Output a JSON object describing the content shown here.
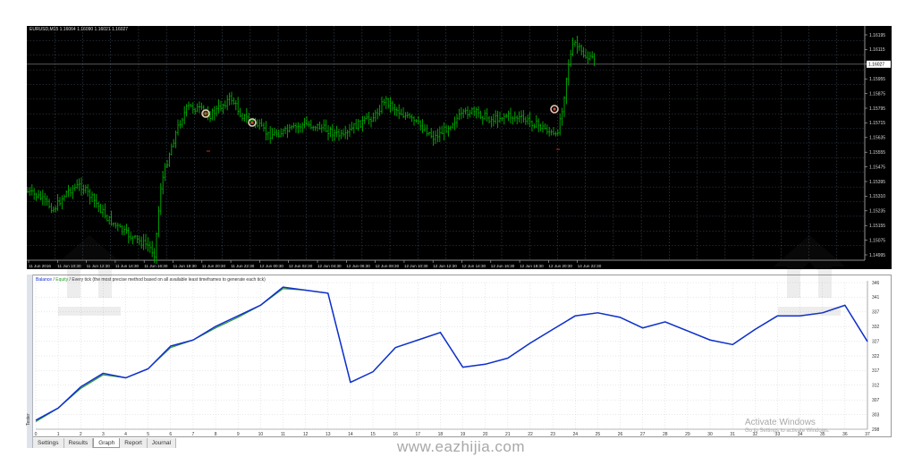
{
  "price_chart": {
    "symbol_line": "EURUSD,M15  1.16064 1.16090 1.16021 1.16027",
    "current_price": "1.16027",
    "price_labels": [
      "1.16195",
      "1.16115",
      "1.16027",
      "1.15955",
      "1.15875",
      "1.15795",
      "1.15715",
      "1.15635",
      "1.15555",
      "1.15475",
      "1.15395",
      "1.15310",
      "1.15235",
      "1.15155",
      "1.15075",
      "1.14995"
    ],
    "time_labels": [
      "11 Jun 2016",
      "11 Jun 10:30",
      "11 Jun 12:30",
      "11 Jun 14:30",
      "11 Jun 16:30",
      "11 Jun 18:30",
      "11 Jun 20:30",
      "11 Jun 22:30",
      "12 Jun 00:30",
      "12 Jun 02:30",
      "12 Jun 04:30",
      "12 Jun 06:30",
      "12 Jun 08:30",
      "12 Jun 10:30",
      "12 Jun 12:30",
      "12 Jun 14:30",
      "12 Jun 16:30",
      "12 Jun 18:30",
      "12 Jun 20:30",
      "14 Jun 22:30"
    ],
    "colors": {
      "bg": "#000000",
      "bars": "#00b400",
      "grid": "#3a4a5a",
      "marker": "#e8c8b8"
    }
  },
  "tester": {
    "caption_balance": "Balance",
    "caption_sep": " / ",
    "caption_equity": "Equity",
    "caption_rest": " / Every tick (the most precise method based on all available least timeframes to generate each tick)",
    "side_label": "Tester",
    "tabs": [
      "Settings",
      "Results",
      "Graph",
      "Report",
      "Journal"
    ],
    "active_tab": "Graph",
    "colors": {
      "balance": "#1030d0",
      "equity": "#2a9a2a",
      "grid": "#d0d0d0"
    }
  },
  "chart_data": {
    "type": "line",
    "title": "",
    "x": [
      0,
      1,
      2,
      3,
      4,
      5,
      6,
      7,
      8,
      9,
      10,
      11,
      12,
      13,
      14,
      15,
      16,
      17,
      18,
      19,
      20,
      21,
      22,
      23,
      24,
      25,
      26,
      27,
      28,
      29,
      30,
      31,
      32,
      33,
      34,
      35,
      36,
      37
    ],
    "x_tick_labels": [
      "0",
      "1",
      "2",
      "3",
      "4",
      "5",
      "6",
      "7",
      "8",
      "9",
      "10",
      "11",
      "12",
      "13",
      "14",
      "15",
      "16",
      "17",
      "18",
      "19",
      "20",
      "21",
      "22",
      "23",
      "24",
      "25",
      "26",
      "27",
      "28",
      "29",
      "30",
      "31",
      "32",
      "33",
      "34",
      "35",
      "36",
      "37"
    ],
    "y_tick_labels": [
      "346",
      "341",
      "337",
      "332",
      "327",
      "322",
      "317",
      "312",
      "307",
      "303",
      "298"
    ],
    "ylim": [
      298,
      346.5
    ],
    "series": [
      {
        "name": "Balance",
        "values": [
          301,
          305,
          312,
          316.5,
          315,
          318,
          325.5,
          327.5,
          332,
          335.5,
          339,
          345,
          344,
          343,
          313.5,
          317,
          325,
          327.5,
          330,
          318.5,
          319.5,
          321.5,
          326.5,
          331,
          335.5,
          336.5,
          335,
          331.5,
          333.5,
          330.5,
          327.5,
          326,
          331,
          335.5,
          335.5,
          336.5,
          339,
          327
        ]
      },
      {
        "name": "Equity",
        "values": [
          300.5,
          305,
          311.5,
          316,
          315,
          318,
          325,
          327.5,
          331.5,
          335,
          339,
          344.5,
          344,
          343,
          313.5,
          317,
          325,
          327.5,
          330,
          318.5,
          319.5,
          321.5,
          326.5,
          331,
          335.5,
          336.5,
          335,
          331.5,
          333.5,
          330.5,
          327.5,
          326,
          331,
          335.5,
          335.5,
          336.5,
          339,
          327
        ]
      }
    ]
  },
  "overlays": {
    "activate_title": "Activate Windows",
    "activate_sub": "Go to Settings to activate Windows.",
    "site": "www.eazhijia.com"
  }
}
